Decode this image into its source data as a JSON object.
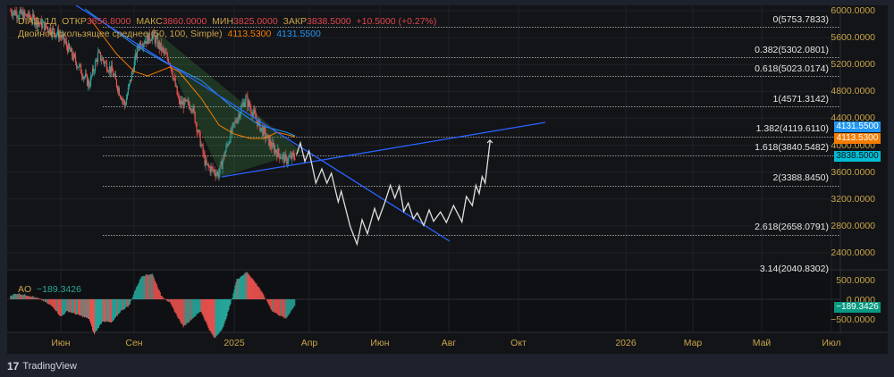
{
  "header": {
    "symbol": "DIAS, 1Д",
    "open_label": "ОТКР",
    "open": "3856.8000",
    "high_label": "МАКС",
    "high": "3860.0000",
    "low_label": "МИН",
    "low": "3825.0000",
    "close_label": "ЗАКР",
    "close": "3838.5000",
    "change": "+10.5000 (+0.27%)",
    "ma_label": "Двойное скользящее среднее (50, 100, Simple)",
    "ma1": "4113.5300",
    "ma2": "4131.5500"
  },
  "price_axis": [
    "6000.0000",
    "5600.0000",
    "5200.0000",
    "4800.0000",
    "4400.0000",
    "4000.0000",
    "3600.0000",
    "3200.0000",
    "2800.0000",
    "2400.0000"
  ],
  "badges": {
    "ma2": "4131.5500",
    "ma1": "4113.5300",
    "last": "3838.5000",
    "ao": "−189.3426"
  },
  "fib_levels": [
    {
      "label": "0(5753.7833)",
      "price": 5753.7833
    },
    {
      "label": "0.382(5302.0801)",
      "price": 5302.0801
    },
    {
      "label": "0.618(5023.0174)",
      "price": 5023.0174
    },
    {
      "label": "1(4571.3142)",
      "price": 4571.3142
    },
    {
      "label": "1.382(4119.6110)",
      "price": 4119.611
    },
    {
      "label": "1.618(3840.5482)",
      "price": 3840.5482
    },
    {
      "label": "2(3388.8450)",
      "price": 3388.845
    },
    {
      "label": "2.618(2658.0791)",
      "price": 2658.0791
    },
    {
      "label": "3.14(2040.8302)",
      "price": 2040.8302
    }
  ],
  "ao": {
    "label": "AO",
    "value": "−189.3426",
    "axis": [
      "500.0000",
      "0.0000",
      "−500.0000"
    ]
  },
  "time_axis": [
    "Июн",
    "Сен",
    "2025",
    "Апр",
    "Июн",
    "Авг",
    "Окт",
    "2026",
    "Мар",
    "Май",
    "Июл"
  ],
  "chart_data": {
    "type": "candlestick",
    "x_unit": "days since 2024-06-01",
    "price_waypoints": [
      [
        -62,
        6000
      ],
      [
        -36,
        5890
      ],
      [
        0,
        5630
      ],
      [
        35,
        4900
      ],
      [
        46,
        5350
      ],
      [
        63,
        5100
      ],
      [
        79,
        4590
      ],
      [
        96,
        5500
      ],
      [
        113,
        5630
      ],
      [
        135,
        5230
      ],
      [
        146,
        4630
      ],
      [
        162,
        4590
      ],
      [
        179,
        3700
      ],
      [
        195,
        3570
      ],
      [
        206,
        4030
      ],
      [
        214,
        4300
      ],
      [
        228,
        4700
      ],
      [
        245,
        4300
      ],
      [
        261,
        3970
      ],
      [
        278,
        3770
      ],
      [
        289,
        3840
      ]
    ],
    "ao_waypoints": [
      [
        -62,
        100
      ],
      [
        -53,
        150
      ],
      [
        -36,
        80
      ],
      [
        -25,
        0
      ],
      [
        -9,
        -200
      ],
      [
        0,
        -450
      ],
      [
        8,
        -300
      ],
      [
        35,
        -500
      ],
      [
        41,
        -900
      ],
      [
        52,
        -550
      ],
      [
        63,
        -600
      ],
      [
        74,
        -300
      ],
      [
        85,
        -150
      ],
      [
        91,
        200
      ],
      [
        100,
        600
      ],
      [
        113,
        650
      ],
      [
        124,
        100
      ],
      [
        135,
        -100
      ],
      [
        151,
        -700
      ],
      [
        162,
        -500
      ],
      [
        173,
        -300
      ],
      [
        184,
        -800
      ],
      [
        190,
        -1000
      ],
      [
        201,
        -700
      ],
      [
        210,
        -100
      ],
      [
        217,
        500
      ],
      [
        230,
        700
      ],
      [
        245,
        300
      ],
      [
        256,
        -100
      ],
      [
        261,
        -300
      ],
      [
        278,
        -500
      ],
      [
        289,
        -150
      ]
    ],
    "price_range": [
      2400,
      6000
    ],
    "colors": {
      "up": "#26a69a",
      "down": "#ef5350",
      "ma1": "#f57c00",
      "ma2": "#2196f3",
      "trend": "#2962ff",
      "forecast": "#e0e0e0"
    }
  },
  "footer": {
    "brand": "TradingView"
  }
}
